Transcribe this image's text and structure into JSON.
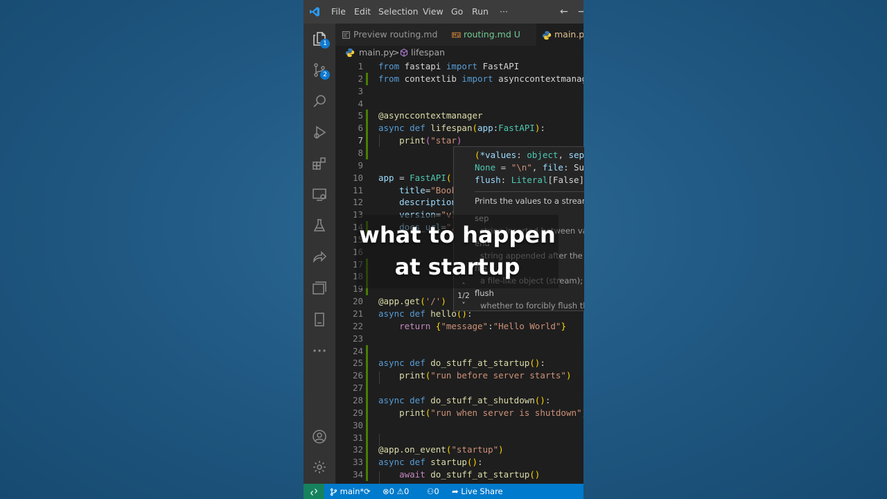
{
  "menu": [
    "File",
    "Edit",
    "Selection",
    "View",
    "Go",
    "Run",
    "···"
  ],
  "activity": {
    "explorer_badge": "1",
    "scm_badge": "2"
  },
  "tabs": [
    {
      "label": "Preview routing.md",
      "badge": ""
    },
    {
      "label": "routing.md",
      "badge": "U"
    },
    {
      "label": "main.py",
      "badge": ""
    }
  ],
  "breadcrumb": {
    "file": "main.py",
    "separator": ">",
    "symbol": "lifespan"
  },
  "lines": [
    {
      "n": "1",
      "t": [
        [
          "kw",
          "from"
        ],
        [
          "plain",
          " fastapi "
        ],
        [
          "kw",
          "import"
        ],
        [
          "plain",
          " FastAPI"
        ]
      ]
    },
    {
      "n": "2",
      "t": [
        [
          "kw",
          "from"
        ],
        [
          "plain",
          " contextlib "
        ],
        [
          "kw",
          "import"
        ],
        [
          "plain",
          " asynccontextmanage"
        ]
      ]
    },
    {
      "n": "3",
      "t": []
    },
    {
      "n": "4",
      "t": []
    },
    {
      "n": "5",
      "t": [
        [
          "fn",
          "@asynccontextmanager"
        ]
      ]
    },
    {
      "n": "6",
      "t": [
        [
          "kw",
          "async def "
        ],
        [
          "fn",
          "lifespan"
        ],
        [
          "br",
          "("
        ],
        [
          "var",
          "app"
        ],
        [
          "plain",
          ":"
        ],
        [
          "cls",
          "FastAPI"
        ],
        [
          "br",
          ")"
        ],
        [
          "plain",
          ":"
        ]
      ]
    },
    {
      "n": "7",
      "t": [
        [
          "plain",
          "    "
        ],
        [
          "fn",
          "print"
        ],
        [
          "br2",
          "("
        ],
        [
          "str",
          "\"star"
        ],
        [
          "br2",
          ")"
        ]
      ]
    },
    {
      "n": "8",
      "t": []
    },
    {
      "n": "9",
      "t": []
    },
    {
      "n": "10",
      "t": [
        [
          "var",
          "app"
        ],
        [
          "plain",
          " = "
        ],
        [
          "cls",
          "FastAPI"
        ],
        [
          "br",
          "("
        ]
      ]
    },
    {
      "n": "11",
      "t": [
        [
          "plain",
          "    "
        ],
        [
          "var",
          "title"
        ],
        [
          "plain",
          "="
        ],
        [
          "str",
          "\"Book"
        ]
      ]
    },
    {
      "n": "12",
      "t": [
        [
          "plain",
          "    "
        ],
        [
          "var",
          "description"
        ]
      ]
    },
    {
      "n": "13",
      "t": [
        [
          "plain",
          "    "
        ],
        [
          "var",
          "version"
        ],
        [
          "plain",
          "="
        ],
        [
          "str",
          "\"v1"
        ]
      ]
    },
    {
      "n": "14",
      "t": [
        [
          "plain",
          "    "
        ],
        [
          "var",
          "docs_url"
        ],
        [
          "plain",
          "="
        ],
        [
          "str",
          "\"/"
        ]
      ]
    },
    {
      "n": "15",
      "t": []
    },
    {
      "n": "16",
      "t": []
    },
    {
      "n": "17",
      "t": []
    },
    {
      "n": "18",
      "t": []
    },
    {
      "n": "19",
      "t": []
    },
    {
      "n": "20",
      "t": [
        [
          "fn",
          "@app.get"
        ],
        [
          "br",
          "("
        ],
        [
          "str",
          "'/'"
        ],
        [
          "br",
          ")"
        ]
      ]
    },
    {
      "n": "21",
      "t": [
        [
          "kw",
          "async def "
        ],
        [
          "fn",
          "hello"
        ],
        [
          "br",
          "()"
        ],
        [
          "plain",
          ":"
        ]
      ]
    },
    {
      "n": "22",
      "t": [
        [
          "plain",
          "    "
        ],
        [
          "kw2",
          "return"
        ],
        [
          "plain",
          " "
        ],
        [
          "br",
          "{"
        ],
        [
          "str",
          "\"message\""
        ],
        [
          "plain",
          ":"
        ],
        [
          "str",
          "\"Hello World\""
        ],
        [
          "br",
          "}"
        ]
      ]
    },
    {
      "n": "23",
      "t": []
    },
    {
      "n": "24",
      "t": []
    },
    {
      "n": "25",
      "t": [
        [
          "kw",
          "async def "
        ],
        [
          "fn",
          "do_stuff_at_startup"
        ],
        [
          "br",
          "()"
        ],
        [
          "plain",
          ":"
        ]
      ]
    },
    {
      "n": "26",
      "t": [
        [
          "plain",
          "    "
        ],
        [
          "fn",
          "print"
        ],
        [
          "br",
          "("
        ],
        [
          "str",
          "\"run before server starts\""
        ],
        [
          "br",
          ")"
        ]
      ]
    },
    {
      "n": "27",
      "t": []
    },
    {
      "n": "28",
      "t": [
        [
          "kw",
          "async def "
        ],
        [
          "fn",
          "do_stuff_at_shutdown"
        ],
        [
          "br",
          "()"
        ],
        [
          "plain",
          ":"
        ]
      ]
    },
    {
      "n": "29",
      "t": [
        [
          "plain",
          "    "
        ],
        [
          "fn",
          "print"
        ],
        [
          "br",
          "("
        ],
        [
          "str",
          "\"run when server is shutdown\""
        ],
        [
          "br",
          ")"
        ]
      ]
    },
    {
      "n": "30",
      "t": []
    },
    {
      "n": "31",
      "t": []
    },
    {
      "n": "32",
      "t": [
        [
          "fn",
          "@app.on_event"
        ],
        [
          "br",
          "("
        ],
        [
          "str",
          "\"startup\""
        ],
        [
          "br",
          ")"
        ]
      ]
    },
    {
      "n": "33",
      "t": [
        [
          "kw",
          "async def "
        ],
        [
          "fn",
          "startup"
        ],
        [
          "br",
          "()"
        ],
        [
          "plain",
          ":"
        ]
      ]
    },
    {
      "n": "34",
      "t": [
        [
          "plain",
          "    "
        ],
        [
          "kw2",
          "await"
        ],
        [
          "plain",
          " "
        ],
        [
          "fn",
          "do_stuff_at_startup"
        ],
        [
          "br",
          "()"
        ]
      ]
    }
  ],
  "hover": {
    "sig": [
      [
        [
          "br",
          "("
        ],
        [
          "var",
          "*values"
        ],
        [
          "plain",
          ": "
        ],
        [
          "cls",
          "object"
        ],
        [
          "plain",
          ", "
        ],
        [
          "var",
          "sep"
        ],
        [
          "plain",
          ":"
        ]
      ],
      [
        [
          "cls",
          "None"
        ],
        [
          "plain",
          " = "
        ],
        [
          "str",
          "\"\\n\""
        ],
        [
          "plain",
          ", "
        ],
        [
          "var",
          "file"
        ],
        [
          "plain",
          ": Sup"
        ]
      ],
      [
        [
          "var",
          "flush"
        ],
        [
          "plain",
          ": "
        ],
        [
          "cls",
          "Literal"
        ],
        [
          "plain",
          "[False]"
        ]
      ]
    ],
    "description": "Prints the values to a stream",
    "params": [
      {
        "name": "sep",
        "desc": "string inserted between va"
      },
      {
        "name": "end",
        "desc": "string appended after the"
      },
      {
        "name": "file",
        "desc": "a file-like object (stream); d"
      },
      {
        "name": "flush",
        "desc": "whether to forcibly flush th"
      }
    ],
    "pager": "1/2"
  },
  "status": {
    "branch": "main*",
    "errors": "0",
    "warnings": "0",
    "ports": "0",
    "live_share": "Live Share"
  },
  "caption": [
    "what to happen",
    "at startup"
  ]
}
